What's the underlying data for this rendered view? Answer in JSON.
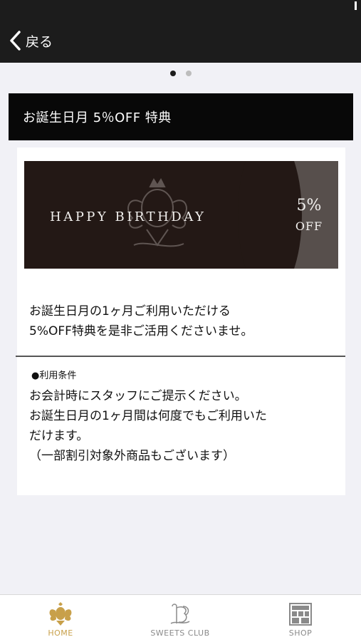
{
  "header": {
    "back_label": "戻る"
  },
  "pager": {
    "count": 2,
    "active": 0
  },
  "title": "お誕生日月 5％OFF 特典",
  "banner": {
    "headline": "HAPPY BIRTHDAY",
    "percent": "5%",
    "off": "OFF"
  },
  "description": {
    "line1": "お誕生日月の1ヶ月ご利用いただける",
    "line2": "5%OFF特典を是非ご活用くださいませ。"
  },
  "conditions": {
    "heading": "●利用条件",
    "line1": "お会計時にスタッフにご提示ください。",
    "line2": "お誕生日月の1ヶ月間は何度でもご利用いた",
    "line3": "だけます。",
    "line4": "（一部割引対象外商品もございます）"
  },
  "tabs": {
    "home": "HOME",
    "club": "SWEETS CLUB",
    "shop": "SHOP"
  },
  "colors": {
    "header_bg": "#1c1c1c",
    "accent_gold": "#c8a04a",
    "banner_bg": "#231815",
    "banner_side": "#574f4c"
  }
}
